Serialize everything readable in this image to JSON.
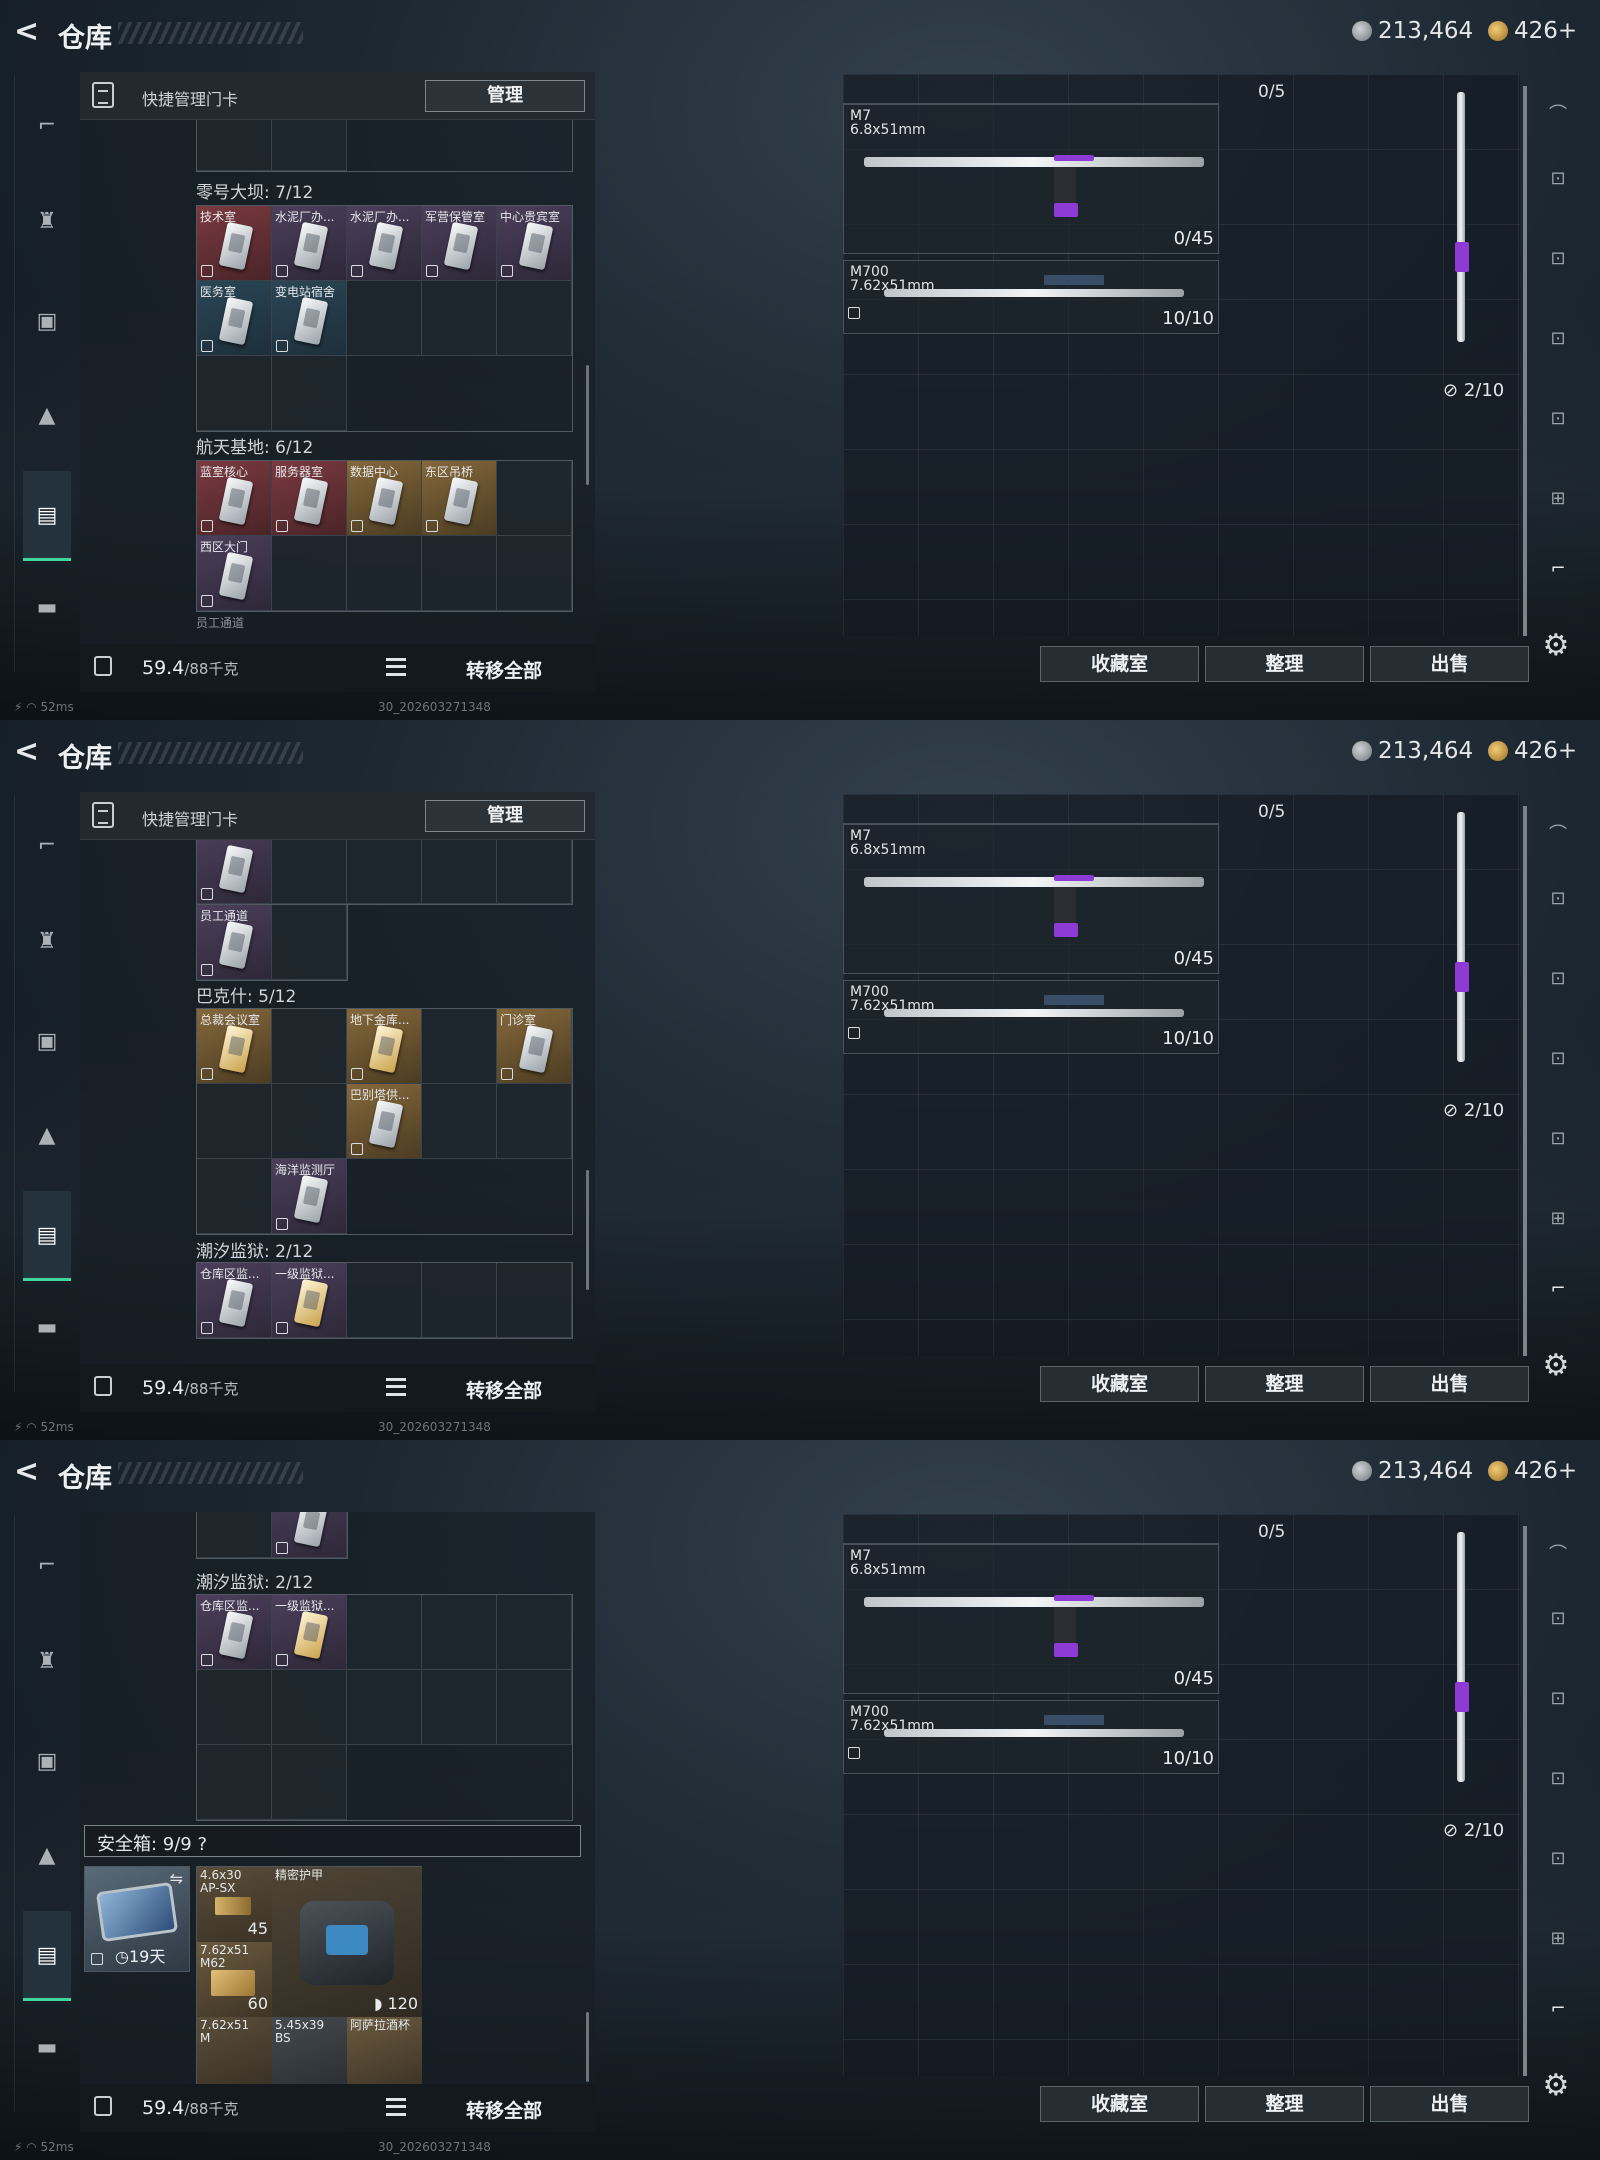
{
  "header": {
    "back_glyph": "<",
    "title": "仓库",
    "silver": "213,464",
    "gold": "426+"
  },
  "nav_icons": [
    "gun-icon",
    "armor-icon",
    "backpack-icon",
    "pouch-icon",
    "keycard-icon",
    "case-icon"
  ],
  "quick_bar": {
    "label": "快捷管理门卡",
    "manage": "管理"
  },
  "weight": {
    "value": "59.4",
    "unit": "/88千克"
  },
  "transfer_all": "转移全部",
  "buttons": {
    "collection": "收藏室",
    "sort": "整理",
    "sell": "出售"
  },
  "weapons": {
    "top_count": "0/5",
    "m7": {
      "name": "M7",
      "caliber": "6.8x51mm",
      "count": "0/45"
    },
    "m700": {
      "name": "M700",
      "caliber": "7.62x51mm",
      "count": "10/10"
    },
    "side_count": "2/10"
  },
  "footer": {
    "ping": "52ms",
    "build": "30_202603271348"
  },
  "panel1": {
    "s1_title": "零号大坝: 7/12",
    "s1_cards": [
      "技术室",
      "水泥厂办...",
      "水泥厂办...",
      "军营保管室",
      "中心贵宾室",
      "医务室",
      "变电站宿舍"
    ],
    "s2_title": "航天基地: 6/12",
    "s2_cards": [
      "蓝室核心",
      "服务器室",
      "数据中心",
      "东区吊桥",
      "西区大门"
    ],
    "s3_partial": "员工通道"
  },
  "panel2": {
    "c_staff": "员工通道",
    "s1_title": "巴克什: 5/12",
    "s1_cards": [
      "总裁会议室",
      "地下金库...",
      "门诊室",
      "巴别塔供...",
      "海洋监测厅"
    ],
    "s2_title": "潮汐监狱: 2/12",
    "s2_cards": [
      "仓库区监...",
      "一级监狱..."
    ]
  },
  "panel3": {
    "s1_title": "潮汐监狱: 2/12",
    "s1_cards": [
      "仓库区监...",
      "一级监狱..."
    ],
    "safe_title": "安全箱: 9/9",
    "safe_help": "?",
    "safe_days": "19天",
    "items": {
      "ammo1_name": "4.6x30 AP-SX",
      "ammo1_count": "45",
      "armor_name": "精密护甲",
      "armor_dur": "120",
      "ammo2_name": "7.62x51 M62",
      "ammo2_count": "60",
      "ammo3_name": "7.62x51 M",
      "ammo4_name": "5.45x39 BS",
      "item5_name": "阿萨拉酒杯"
    }
  }
}
